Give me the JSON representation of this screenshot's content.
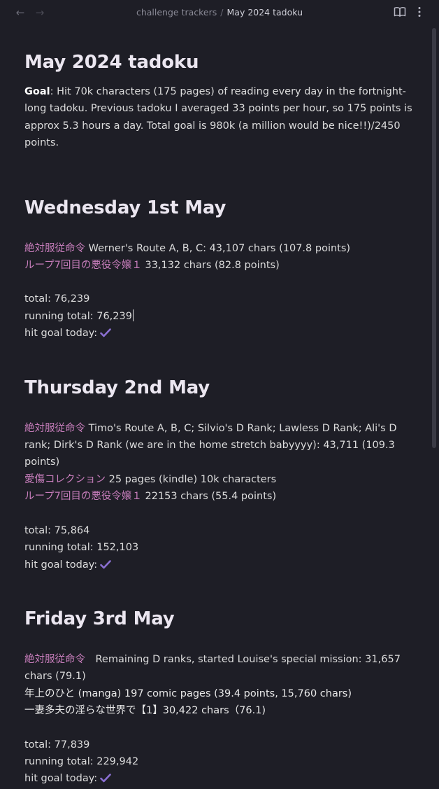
{
  "nav": {
    "back_icon": "←",
    "forward_icon": "→"
  },
  "breadcrumb": {
    "parent": "challenge trackers",
    "separator": "/",
    "current": "May 2024 tadoku"
  },
  "page": {
    "title": "May 2024 tadoku",
    "goal_label": "Goal",
    "goal_text": ": Hit 70k characters (175 pages) of reading every day in the fortnight-long tadoku. Previous tadoku I averaged 33 points per hour, so 175 points is approx 5.3 hours a day. Total goal is 980k (a million would be nice!!)/2450 points."
  },
  "days": [
    {
      "heading": "Wednesday 1st May",
      "entries": [
        {
          "title": "絶対服従命令",
          "text": " Werner's Route A, B, C: 43,107 chars (107.8 points)"
        },
        {
          "title": "ループ7回目の悪役令嬢１",
          "text": " 33,132 chars (82.8 points)"
        }
      ],
      "total": "total: 76,239",
      "running_total": "running total: 76,239",
      "hit_goal": "hit goal today:"
    },
    {
      "heading": "Thursday 2nd May",
      "entries": [
        {
          "title": "絶対服従命令",
          "text": " Timo's Route A, B, C; Silvio's D Rank; Lawless D Rank; Ali's D rank; Dirk's D Rank (we are in the home stretch babyyyy): 43,711 (109.3 points)"
        },
        {
          "title": "愛傷コレクション",
          "text": " 25 pages (kindle) 10k characters"
        },
        {
          "title": "ループ7回目の悪役令嬢１",
          "text": " 22153 chars (55.4 points)"
        }
      ],
      "total": "total: 75,864",
      "running_total": "running total: 152,103",
      "hit_goal": "hit goal today:"
    },
    {
      "heading": "Friday 3rd May",
      "entries": [
        {
          "title": "絶対服従命令",
          "text": "　Remaining D ranks, started Louise's special mission: 31,657 chars (79.1)"
        },
        {
          "title": "",
          "text": "年上のひと (manga) 197 comic pages (39.4 points, 15,760 chars)"
        },
        {
          "title": "",
          "text": "一妻多夫の淫らな世界で【1】30,422 chars（76.1)"
        }
      ],
      "total": "total: 77,839",
      "running_total": "running total: 229,942",
      "hit_goal": "hit goal today:"
    }
  ],
  "colors": {
    "background": "#1e1e26",
    "text": "#dcdcdc",
    "heading": "#ebe6f0",
    "link_title": "#c77dbb",
    "check": "#8a6fd1"
  },
  "icons": {
    "reading_mode": "book-open-icon",
    "more_options": "vertical-dots-icon",
    "check": "checkmark-icon"
  }
}
